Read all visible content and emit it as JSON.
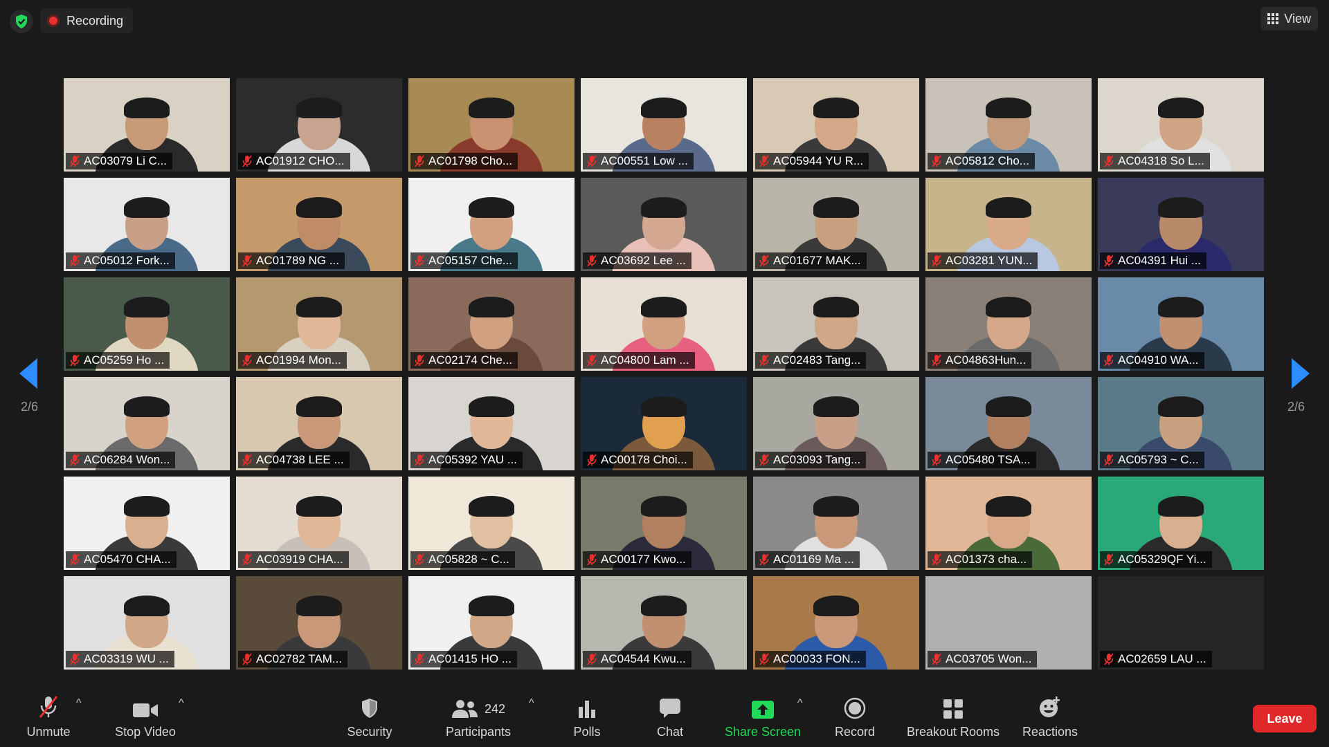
{
  "topbar": {
    "recording_label": "Recording",
    "view_label": "View"
  },
  "pagination": {
    "left": "2/6",
    "right": "2/6"
  },
  "participants": [
    {
      "name": "AC03079 Li C...",
      "bg": "#d9d2c4",
      "skin": "#c99a78",
      "shirt": "#2a2a2a"
    },
    {
      "name": "AC01912 CHO...",
      "bg": "#2c2c2c",
      "skin": "#c8a490",
      "shirt": "#d8d8d8"
    },
    {
      "name": "AC01798 Cho...",
      "bg": "#a88a55",
      "skin": "#c99270",
      "shirt": "#8a3a2a"
    },
    {
      "name": "AC00551 Low ...",
      "bg": "#e8e4de",
      "skin": "#b88260",
      "shirt": "#5a6a8a"
    },
    {
      "name": "AC05944 YU R...",
      "bg": "#d8c9b4",
      "skin": "#d4a888",
      "shirt": "#3a3a3a"
    },
    {
      "name": "AC05812 Cho...",
      "bg": "#c8c2b8",
      "skin": "#c49a7c",
      "shirt": "#6a8aa6"
    },
    {
      "name": "AC04318 So L...",
      "bg": "#dcd6cc",
      "skin": "#d0a484",
      "shirt": "#e0e0e0"
    },
    {
      "name": "AC05012 Fork...",
      "bg": "#e8e8e8",
      "skin": "#c8a088",
      "shirt": "#4a6a8a"
    },
    {
      "name": "AC01789 NG ...",
      "bg": "#c49a6a",
      "skin": "#c08c68",
      "shirt": "#3a4a5a"
    },
    {
      "name": "AC05157 Che...",
      "bg": "#f0f0f0",
      "skin": "#d0a080",
      "shirt": "#4a7a8a"
    },
    {
      "name": "AC03692 Lee ...",
      "bg": "#5a5a5a",
      "skin": "#d4a890",
      "shirt": "#e8c0b8"
    },
    {
      "name": "AC01677 MAK...",
      "bg": "#b8b4a8",
      "skin": "#c8a080",
      "shirt": "#3a3a3a"
    },
    {
      "name": "AC03281 YUN...",
      "bg": "#c8b48a",
      "skin": "#d8aa88",
      "shirt": "#b8c8e0"
    },
    {
      "name": "AC04391 Hui ...",
      "bg": "#3a3a5a",
      "skin": "#b88a6a",
      "shirt": "#2a2a6a"
    },
    {
      "name": "AC05259 Ho ...",
      "bg": "#4a5a4a",
      "skin": "#c09070",
      "shirt": "#e0d8c0"
    },
    {
      "name": "AC01994 Mon...",
      "bg": "#b49870",
      "skin": "#e0b898",
      "shirt": "#d8d0c0"
    },
    {
      "name": "AC02174 Che...",
      "bg": "#8a6a5a",
      "skin": "#d0a080",
      "shirt": "#6a4a3a"
    },
    {
      "name": "AC04800 Lam ...",
      "bg": "#e8e0d4",
      "skin": "#d0a080",
      "shirt": "#e86080"
    },
    {
      "name": "AC02483 Tang...",
      "bg": "#c8c4bc",
      "skin": "#d0a888",
      "shirt": "#3a3a3a"
    },
    {
      "name": "AC04863Hun...",
      "bg": "#8a8078",
      "skin": "#d4a888",
      "shirt": "#6a6a6a"
    },
    {
      "name": "AC04910 WA...",
      "bg": "#6a8aaa",
      "skin": "#c09070",
      "shirt": "#2a3a4a"
    },
    {
      "name": "AC06284 Won...",
      "bg": "#d8d4cc",
      "skin": "#d0a080",
      "shirt": "#6a6a6a"
    },
    {
      "name": "AC04738 LEE ...",
      "bg": "#d8c8b0",
      "skin": "#c89878",
      "shirt": "#2a2a2a"
    },
    {
      "name": "AC05392 YAU ...",
      "bg": "#d8d4d0",
      "skin": "#e0b898",
      "shirt": "#2a2a2a"
    },
    {
      "name": "AC00178 Choi...",
      "bg": "#1a2a3a",
      "skin": "#e0a050",
      "shirt": "#7a5a3a"
    },
    {
      "name": "AC03093 Tang...",
      "bg": "#a8a8a0",
      "skin": "#c8a088",
      "shirt": "#6a5a5a"
    },
    {
      "name": "AC05480 TSA...",
      "bg": "#7a8a9a",
      "skin": "#b08060",
      "shirt": "#2a2a2a"
    },
    {
      "name": "AC05793 ~ C...",
      "bg": "#5a7a8a",
      "skin": "#c8a080",
      "shirt": "#3a4a6a"
    },
    {
      "name": "AC05470 CHA...",
      "bg": "#f0f0f0",
      "skin": "#d8b090",
      "shirt": "#3a3a3a"
    },
    {
      "name": "AC03919 CHA...",
      "bg": "#e4dcd0",
      "skin": "#e0b898",
      "shirt": "#c8c0b8"
    },
    {
      "name": "AC05828 ~ C...",
      "bg": "#f0e8d8",
      "skin": "#e0c0a0",
      "shirt": "#4a4a4a"
    },
    {
      "name": "AC00177 Kwo...",
      "bg": "#7a7a6a",
      "skin": "#b08060",
      "shirt": "#2a2a3a"
    },
    {
      "name": "AC01169 Ma ...",
      "bg": "#8a8a8a",
      "skin": "#c89878",
      "shirt": "#e0e0e0"
    },
    {
      "name": "AC01373 cha...",
      "bg": "#e0b898",
      "skin": "#d8a888",
      "shirt": "#4a6a3a"
    },
    {
      "name": "AC05329QF Yi...",
      "bg": "#2aa878",
      "skin": "#d8b090",
      "shirt": "#2a2a2a"
    },
    {
      "name": "AC03319 WU ...",
      "bg": "#e0e0e0",
      "skin": "#d0a888",
      "shirt": "#e8e0d0"
    },
    {
      "name": "AC02782 TAM...",
      "bg": "#5a4a3a",
      "skin": "#c89878",
      "shirt": "#3a3a3a"
    },
    {
      "name": "AC01415 HO ...",
      "bg": "#f0f0f0",
      "skin": "#d0a888",
      "shirt": "#3a3a3a"
    },
    {
      "name": "AC04544 Kwu...",
      "bg": "#b8b8b0",
      "skin": "#c09070",
      "shirt": "#3a3a3a"
    },
    {
      "name": "AC00033 FON...",
      "bg": "#a87a4a",
      "skin": "#c89878",
      "shirt": "#2a5aa8"
    },
    {
      "name": "AC03705 Won...",
      "bg": "#b0b0b0",
      "skin": "",
      "shirt": ""
    },
    {
      "name": "AC02659 LAU ...",
      "bg": "#262626",
      "skin": "",
      "shirt": ""
    }
  ],
  "toolbar": {
    "unmute": "Unmute",
    "stop_video": "Stop Video",
    "security": "Security",
    "participants_count": "242",
    "participants": "Participants",
    "polls": "Polls",
    "chat": "Chat",
    "share_screen": "Share Screen",
    "record": "Record",
    "breakout_rooms": "Breakout Rooms",
    "reactions": "Reactions",
    "leave": "Leave"
  },
  "colors": {
    "accent": "#2d8cff",
    "share_green": "#23d959",
    "leave_red": "#e02828",
    "muted_red": "#e8312e"
  }
}
